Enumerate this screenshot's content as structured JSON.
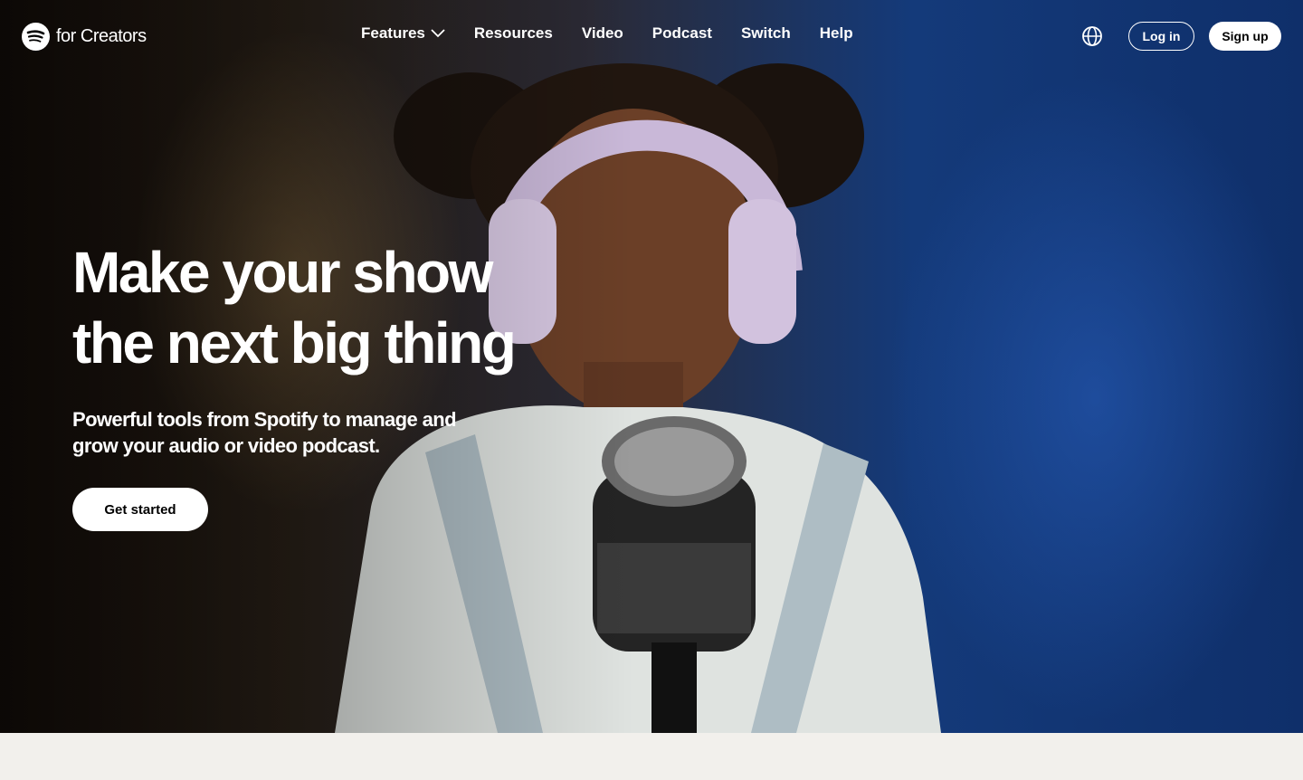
{
  "brand": {
    "logo_text": "for Creators",
    "logo_icon": "spotify-logo-icon"
  },
  "nav": {
    "items": [
      {
        "label": "Features",
        "has_dropdown": true
      },
      {
        "label": "Resources"
      },
      {
        "label": "Video"
      },
      {
        "label": "Podcast"
      },
      {
        "label": "Switch"
      },
      {
        "label": "Help"
      }
    ],
    "language_icon": "globe-icon",
    "login_label": "Log in",
    "signup_label": "Sign up"
  },
  "hero": {
    "headline_line1": "Make your show",
    "headline_line2": "the next big thing",
    "subtext": "Powerful tools from Spotify to manage and grow your audio or video podcast.",
    "cta_label": "Get started"
  },
  "colors": {
    "text_on_dark": "#ffffff",
    "button_fill": "#ffffff",
    "below_fold_background": "#f2f0ec"
  }
}
